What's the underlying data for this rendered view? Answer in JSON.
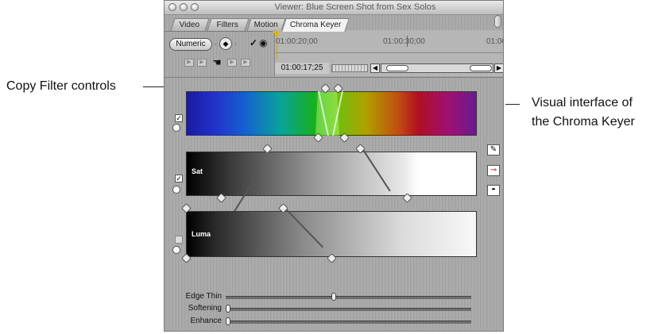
{
  "window": {
    "title": "Viewer: Blue Screen Shot from Sex Solos",
    "tabs": [
      "Video",
      "Filters",
      "Motion",
      "Chroma Keyer"
    ],
    "active_tab": "Chroma Keyer"
  },
  "toolbar": {
    "numeric_button": "Numeric",
    "timecodes": [
      "01:00:20;00",
      "01:00:30;00",
      "01:00"
    ],
    "current_timecode": "01:00:17;25"
  },
  "controls": {
    "sat_label": "Sat",
    "luma_label": "Luma"
  },
  "sliders": [
    {
      "label": "Edge Thin",
      "value": 0.44
    },
    {
      "label": "Softening",
      "value": 0.0
    },
    {
      "label": "Enhance",
      "value": 0.0
    }
  ],
  "callouts": {
    "left": "Copy Filter controls",
    "right_line1": "Visual interface of",
    "right_line2": "the Chroma Keyer"
  }
}
